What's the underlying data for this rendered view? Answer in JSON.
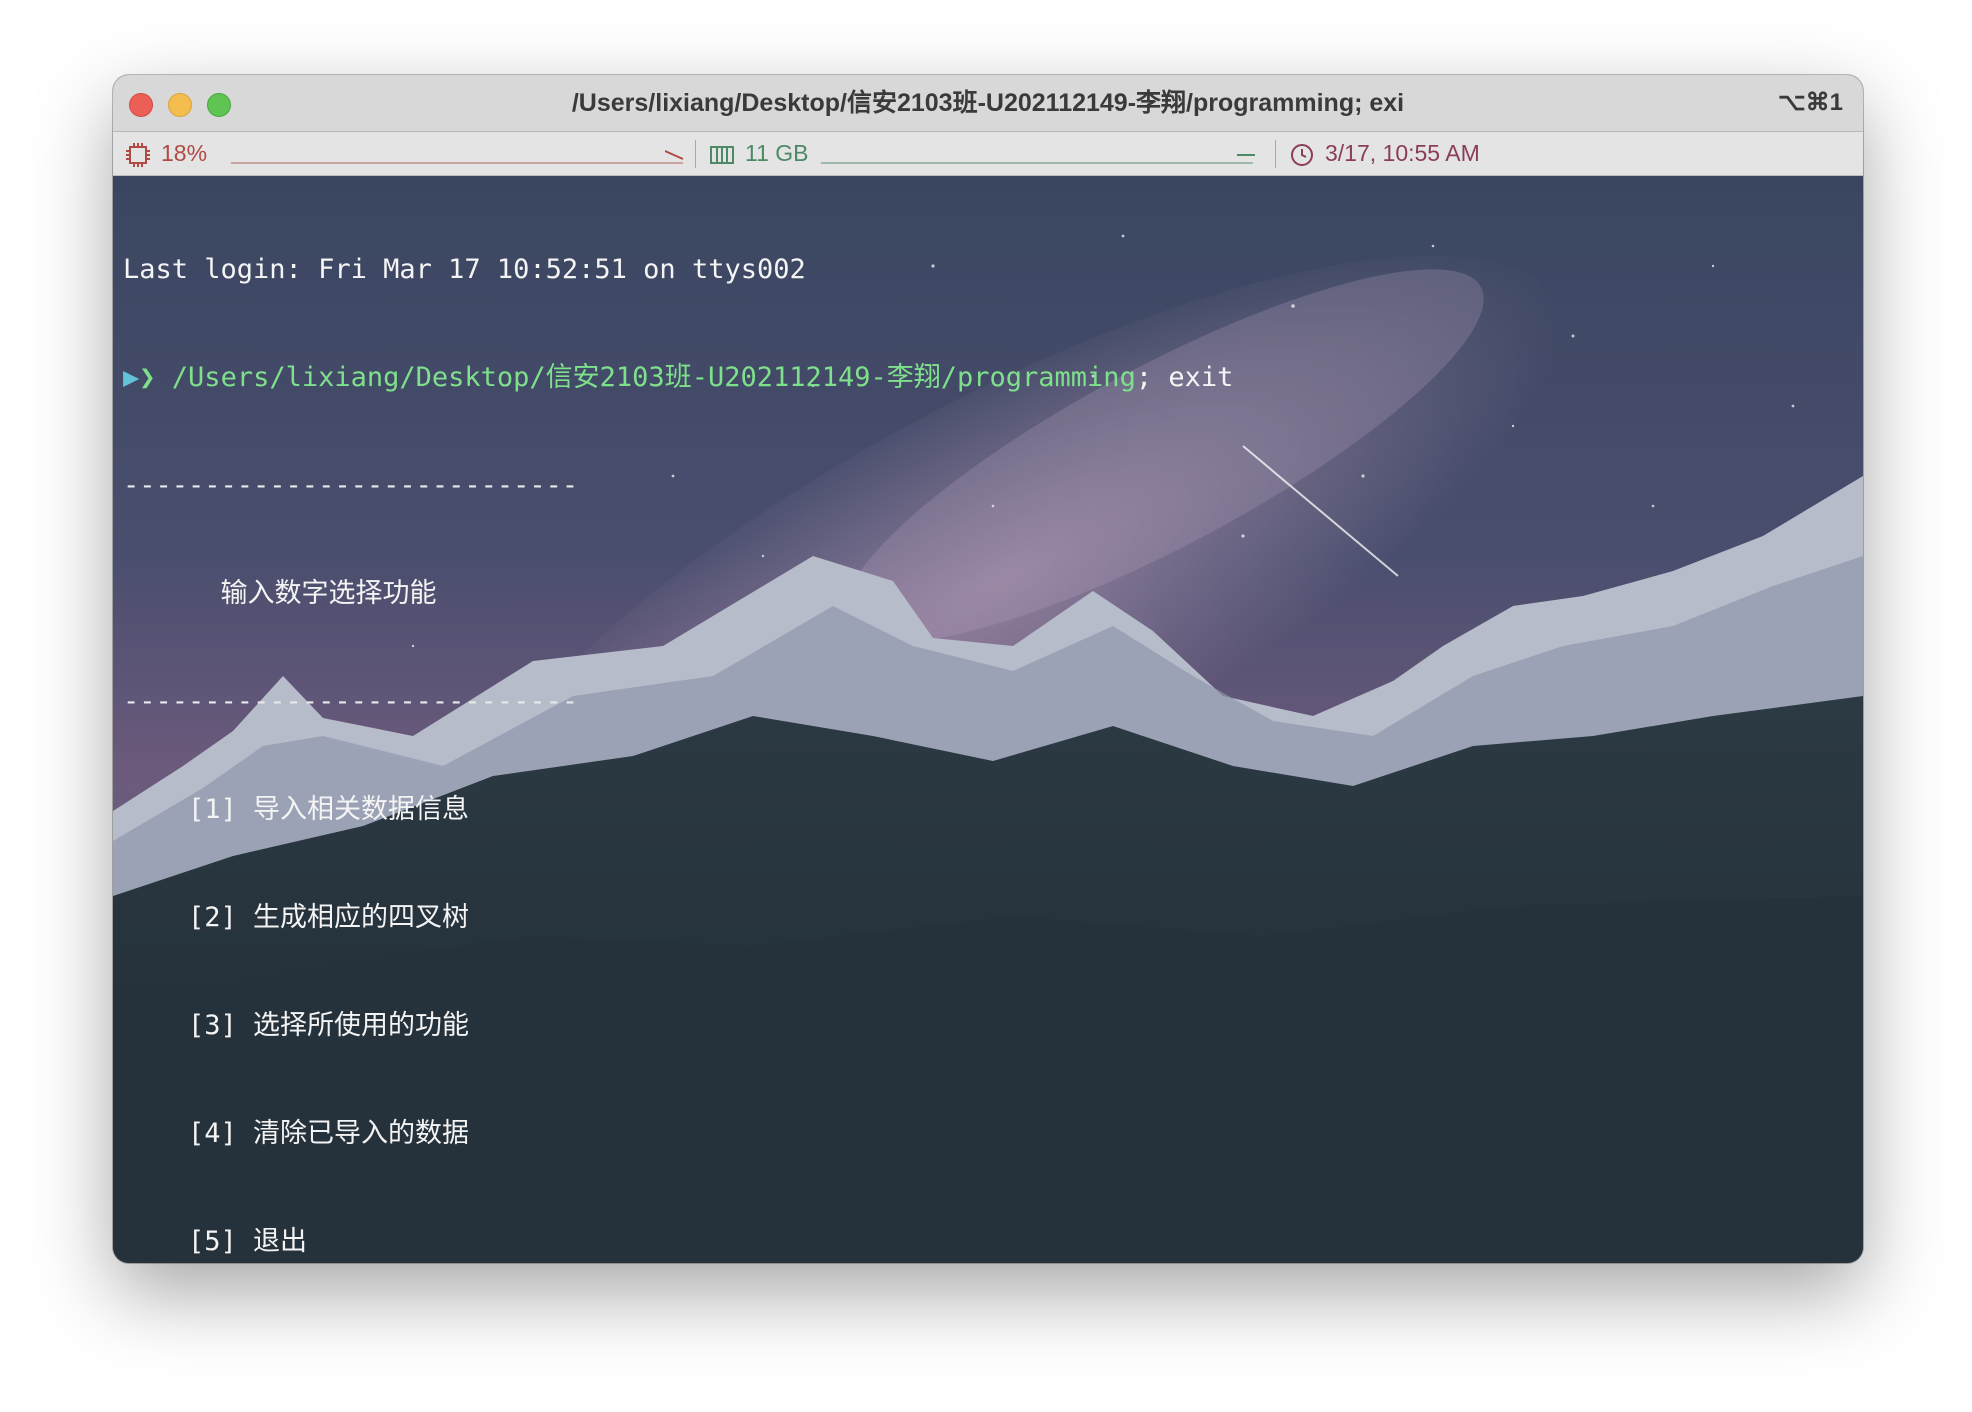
{
  "window": {
    "title": "/Users/lixiang/Desktop/信安2103班-U202112149-李翔/programming; exi",
    "shortcut": "⌥⌘1"
  },
  "statusbar": {
    "cpu_value": "18%",
    "memory_value": "11 GB",
    "datetime": "3/17, 10:55 AM",
    "cpu_color": "#b04a43",
    "memory_color": "#4c8a66",
    "clock_color": "#8a3d5a"
  },
  "terminal": {
    "last_login": "Last login: Fri Mar 17 10:52:51 on ttys002",
    "prompt_symbol": "❯",
    "command_path": "/Users/lixiang/Desktop/信安2103班-U202112149-李翔/programming",
    "command_rest": "; exit",
    "rule": "----------------------------",
    "menu_title": "      输入数字选择功能",
    "menu_items": [
      "    [1] 导入相关数据信息",
      "    [2] 生成相应的四叉树",
      "    [3] 选择所使用的功能",
      "    [4] 清除已导入的数据",
      "    [5] 退出"
    ]
  },
  "icons": {
    "cpu": "cpu-chip-icon",
    "memory": "memory-icon",
    "clock": "clock-icon"
  }
}
